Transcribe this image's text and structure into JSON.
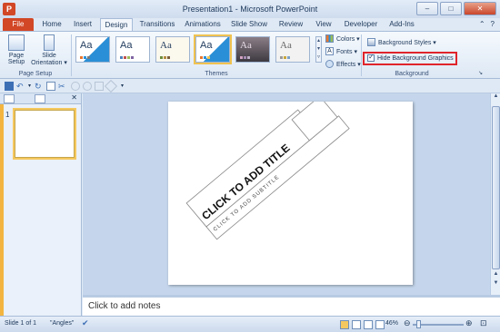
{
  "window": {
    "title": "Presentation1 - Microsoft PowerPoint",
    "app_icon_letter": "P",
    "minimize": "–",
    "maximize": "□",
    "close": "✕"
  },
  "tabs": [
    {
      "label": "File"
    },
    {
      "label": "Home"
    },
    {
      "label": "Insert"
    },
    {
      "label": "Design"
    },
    {
      "label": "Transitions"
    },
    {
      "label": "Animations"
    },
    {
      "label": "Slide Show"
    },
    {
      "label": "Review"
    },
    {
      "label": "View"
    },
    {
      "label": "Developer"
    },
    {
      "label": "Add-Ins"
    }
  ],
  "active_tab": "Design",
  "ribbon": {
    "page_setup": {
      "group_label": "Page Setup",
      "page_setup_btn": "Page Setup",
      "page_setup_l1": "Page",
      "page_setup_l2": "Setup",
      "orientation_l1": "Slide",
      "orientation_l2": "Orientation ▾"
    },
    "themes": {
      "group_label": "Themes",
      "colors": "Colors ▾",
      "fonts": "Fonts ▾",
      "effects": "Effects ▾",
      "thumb_text": "Aa"
    },
    "background": {
      "group_label": "Background",
      "styles": "Background Styles ▾",
      "hide_graphics": "Hide Background Graphics",
      "hide_graphics_checked": true
    }
  },
  "slide": {
    "title_placeholder": "CLICK TO ADD TITLE",
    "subtitle_placeholder": "CLICK TO ADD SUBTITLE"
  },
  "slides_pane": {
    "slide_number": "1"
  },
  "notes": {
    "placeholder": "Click to add notes"
  },
  "status": {
    "slide_info": "Slide 1 of 1",
    "theme_name": "\"Angles\"",
    "zoom": "46%",
    "zoom_level_fraction": 0.46
  },
  "colors": {
    "file_tab": "#d24726",
    "selection_outline": "#f0c24f",
    "highlight_box": "#e0242b"
  }
}
